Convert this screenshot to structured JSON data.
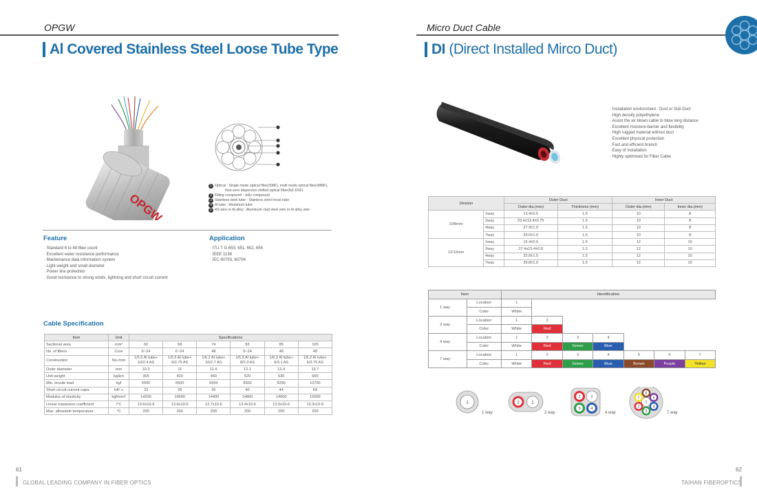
{
  "left": {
    "section": "OPGW",
    "title": "Al Covered Stainless Steel Loose Tube Type",
    "opgw_label": "OPGW",
    "legend": [
      {
        "num": "1",
        "text": "Optical : Single mode optical fiber(SMF), multi mode optical fiber(MMF),"
      },
      {
        "num": "",
        "text": "Non-zero dispersion shifted optical fiber(NZ-DSF)"
      },
      {
        "num": "2",
        "text": "Filling compound : Jelly compound"
      },
      {
        "num": "3",
        "text": "Stainless steel tube : Stainless steel loose tube"
      },
      {
        "num": "4",
        "text": "Al tube : Aluminum tube"
      },
      {
        "num": "5",
        "text": "AS wire or Al alloy : Aluminum clad steel wire or Al alloy wire"
      }
    ],
    "feature": {
      "heading": "Feature",
      "items": [
        "Standard 6 to 48 fiber count",
        "Excellent water resistance performance",
        "Maintenance data information system",
        "Light weight and small diameter",
        "Power line protection",
        "Good resistance to strong winds, lightning and short circuit current"
      ]
    },
    "application": {
      "heading": "Application",
      "items": [
        "ITU-T G.650, 651, 652, 655",
        "IEEE 1138",
        "IEC 60793, 60794"
      ]
    },
    "spec": {
      "heading": "Cable Specification",
      "headers": [
        "Item",
        "Unit",
        "Specifications"
      ],
      "rows": [
        {
          "item": "Sectional area",
          "unit": "mm²",
          "vals": [
            "60",
            "68",
            "74",
            "83",
            "85",
            "105"
          ]
        },
        {
          "item": "No. of fibers",
          "unit": "Core",
          "vals": [
            "6~24",
            "6~24",
            "48",
            "6~24",
            "48",
            "48"
          ]
        },
        {
          "item": "Construction",
          "unit": "No./mm",
          "vals": [
            "1/5.5 Al tube+\n10/2.4 AS",
            "1/5.5 Al tube+\n9/2.75 AS",
            "1/6.2 Al tube+\n10/2.7 AS",
            "1/5.5 Al tube+\n8/2.3 AS",
            "1/6.2 Al tube+\n9/3.1 AS",
            "1/6.2 Al tube+\n6/3.75 AS"
          ]
        },
        {
          "item": "Outer diameter",
          "unit": "mm",
          "vals": [
            "10.3",
            "11",
            "11.6",
            "12.1",
            "12.4",
            "13.7"
          ]
        },
        {
          "item": "Unit weight",
          "unit": "kg/km",
          "vals": [
            "365",
            "420",
            "450",
            "520",
            "530",
            "665"
          ]
        },
        {
          "item": "Min. tensile load",
          "unit": "kgf",
          "vals": [
            "5500",
            "6500",
            "6950",
            "8300",
            "8250",
            "10700"
          ]
        },
        {
          "item": "Short circuit current capa.",
          "unit": "kA² s",
          "vals": [
            "33",
            "28",
            "35",
            "40",
            "44",
            "64"
          ]
        },
        {
          "item": "Modulus of elasticity",
          "unit": "kgf/mm²",
          "vals": [
            "14200",
            "14500",
            "14400",
            "14800",
            "14600",
            "15000"
          ]
        },
        {
          "item": "Linear expansion coefficient",
          "unit": "/°C",
          "vals": [
            "13.6x10-6",
            "13.6x10-6",
            "13.7x10-6",
            "13.4x10-6",
            "13.5x10-6",
            "13.3x10-6"
          ]
        },
        {
          "item": "Max. allowable temperature",
          "unit": "°C",
          "vals": [
            "200",
            "200",
            "200",
            "200",
            "200",
            "200"
          ]
        }
      ]
    },
    "page_num": "61",
    "footer": "GLOBAL LEADING COMPANY IN FIBER OPTICS"
  },
  "right": {
    "section": "Micro Duct Cable",
    "title_bold": "DI",
    "title_rest": " (Direct Installed Mirco Duct)",
    "features": [
      "Installation environment : Duct or Sub Duct",
      "High density polyethylene",
      "Assist the air blown cable to blow long distance",
      "Excellent moisture-barrier and flexibility",
      "High rugged material without duct",
      "Excellent physical protection",
      "Fast and efficient branch",
      "Easy of installation",
      "Highly optimized for Fiber Cable"
    ],
    "duct_table": {
      "division": "Division",
      "outer_duct": "Outer Duct",
      "inner_duct": "Inner Duct",
      "sub_headers": [
        "Outer dia.(mm)",
        "Thickness (mm)",
        "Outer dia.(mm)",
        "Inner dia.(mm)"
      ],
      "groups": [
        {
          "name": "10/8mm",
          "rows": [
            {
              "way": "1way",
              "od": "13.4±0.5",
              "th": "1.5",
              "iod": "10",
              "iid": "8"
            },
            {
              "way": "2way",
              "od": "23.4x13.4±0.75",
              "th": "1.5",
              "iod": "10",
              "iid": "8"
            },
            {
              "way": "4way",
              "od": "27.9±1.0",
              "th": "1.5",
              "iod": "10",
              "iid": "8"
            },
            {
              "way": "7way",
              "od": "33.6±1.0",
              "th": "1.5",
              "iod": "10",
              "iid": "8"
            }
          ]
        },
        {
          "name": "12/10mm",
          "rows": [
            {
              "way": "1way",
              "od": "15.4±0.5",
              "th": "1.5",
              "iod": "12",
              "iid": "10"
            },
            {
              "way": "2way",
              "od": "27.4x15.4±0.8",
              "th": "1.5",
              "iod": "12",
              "iid": "10"
            },
            {
              "way": "4way",
              "od": "32.8±1.0",
              "th": "1.5",
              "iod": "12",
              "iid": "10"
            },
            {
              "way": "7way",
              "od": "39.8±1.0",
              "th": "1.5",
              "iod": "12",
              "iid": "10"
            }
          ]
        }
      ]
    },
    "id_table": {
      "item": "Item",
      "identification": "Identification",
      "location": "Location",
      "color": "Color",
      "groups": [
        {
          "name": "1 way",
          "locs": [
            "1"
          ],
          "colors": [
            "White"
          ]
        },
        {
          "name": "2 way",
          "locs": [
            "1",
            "2"
          ],
          "colors": [
            "White",
            "Red"
          ]
        },
        {
          "name": "4 way",
          "locs": [
            "1",
            "2",
            "3",
            "4"
          ],
          "colors": [
            "White",
            "Red",
            "Green",
            "Blue"
          ]
        },
        {
          "name": "7 way",
          "locs": [
            "1",
            "2",
            "3",
            "4",
            "5",
            "6",
            "7"
          ],
          "colors": [
            "White",
            "Red",
            "Green",
            "Blue",
            "Brown",
            "Purple",
            "Yellow"
          ]
        }
      ]
    },
    "color_map": {
      "White": "#ffffff",
      "Red": "#e0313a",
      "Green": "#2e9e4a",
      "Blue": "#2a5db0",
      "Brown": "#8b4a2b",
      "Purple": "#7b3fa0",
      "Yellow": "#f2e32a"
    },
    "diagram_labels": [
      "1 way",
      "2 way",
      "4 way",
      "7 way"
    ],
    "page_num": "62",
    "footer": "TAIHAN FIBEROPTICS"
  }
}
